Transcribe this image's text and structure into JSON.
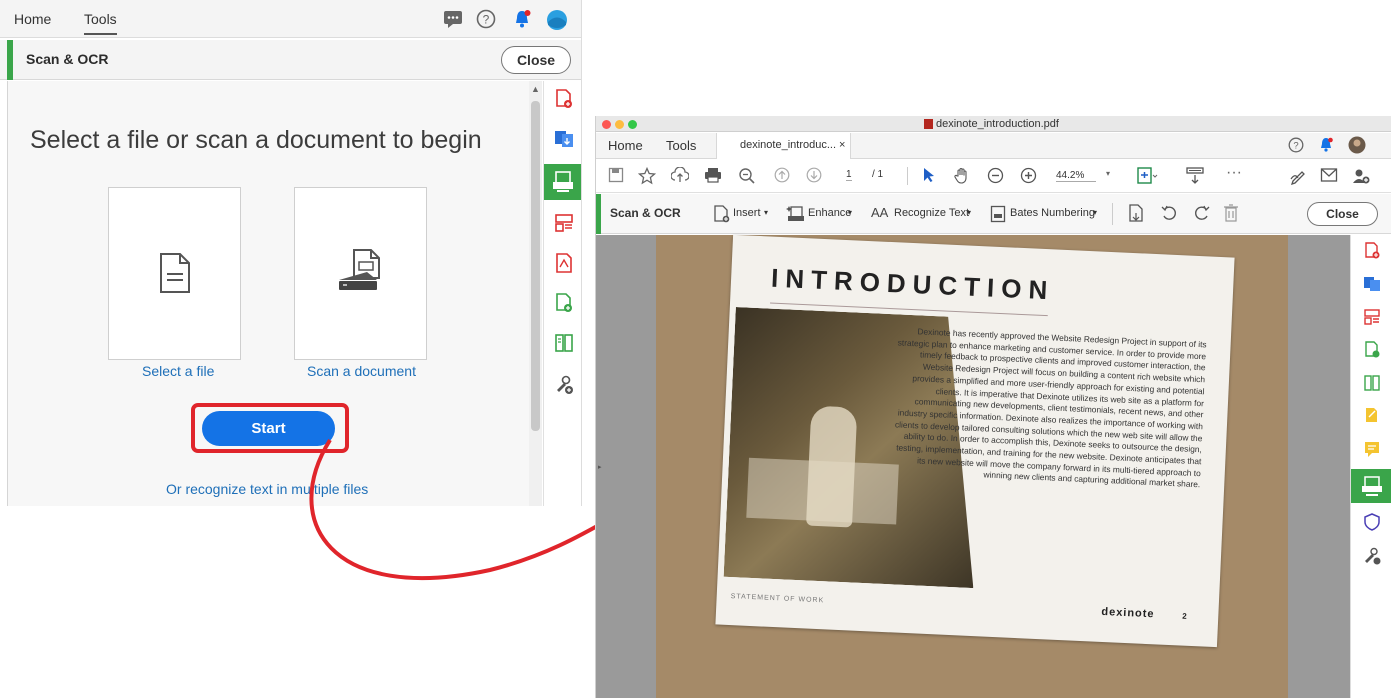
{
  "left_panel": {
    "tabs": [
      "Home",
      "Tools"
    ],
    "tool_title": "Scan & OCR",
    "close_label": "Close",
    "heading": "Select a file or scan a document to begin",
    "select_file_label": "Select a file",
    "scan_document_label": "Scan a document",
    "start_label": "Start",
    "recognize_label": "Or recognize text in multiple files",
    "accent_color": "#3aa54a",
    "button_color": "#1473e6",
    "highlight_color": "#e0252b"
  },
  "right_window": {
    "window_title": "dexinote_introduction.pdf",
    "tabs": [
      "Home",
      "Tools"
    ],
    "doc_tab": "dexinote_introduc...",
    "doc_tab_close": "×",
    "page_current": "1",
    "page_total": "/ 1",
    "zoom": "44.2%",
    "tool_title": "Scan & OCR",
    "insert_label": "Insert",
    "enhance_label": "Enhance",
    "recognize_label": "Recognize Text",
    "bates_label": "Bates Numbering",
    "close_label": "Close",
    "document": {
      "title": "INTRODUCTION",
      "body": "Dexinote has recently approved the Website Redesign Project in support of its strategic plan to enhance marketing and customer service. In order to provide more timely feedback to prospective clients and improved customer interaction, the Website Redesign Project will focus on building a content rich website which provides a simplified and more user-friendly approach for existing and potential clients. It is imperative that Dexinote utilizes its web site as a platform for communicating new developments, client testimonials, recent news, and other industry specific information. Dexinote also realizes the importance of working with clients to develop tailored consulting solutions which the new web site will allow the ability to do. In order to accomplish this, Dexinote seeks to outsource the design, testing, implementation, and training for the new website. Dexinote anticipates that its new website will move the company forward in its multi-tiered approach to winning new clients and capturing additional market share.",
      "footer": "STATEMENT OF WORK",
      "brand": "dexinote",
      "page_number": "2"
    }
  }
}
